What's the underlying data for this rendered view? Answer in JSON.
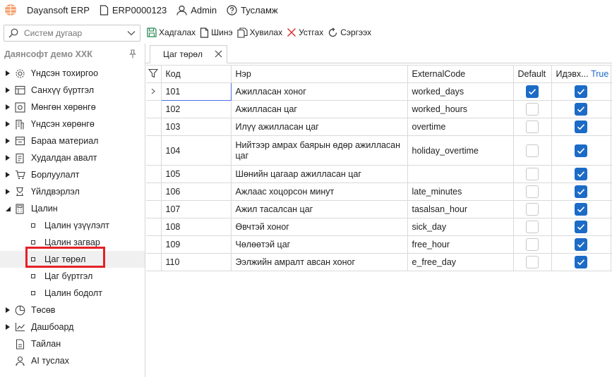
{
  "topbar": {
    "app_name": "Dayansoft ERP",
    "record": "ERP0000123",
    "user": "Admin",
    "help": "Тусламж"
  },
  "search": {
    "placeholder": "Систем дугаар"
  },
  "company": "Даянсофт демо ХХК",
  "nav": {
    "items": [
      {
        "label": "Үндсэн тохиргоо",
        "icon": "gear-icon"
      },
      {
        "label": "Санхүү бүртгэл",
        "icon": "ledger-icon"
      },
      {
        "label": "Мөнгөн хөрөнгө",
        "icon": "money-icon"
      },
      {
        "label": "Үндсэн хөрөнгө",
        "icon": "building-icon"
      },
      {
        "label": "Бараа материал",
        "icon": "box-icon"
      },
      {
        "label": "Худалдан авалт",
        "icon": "purchase-icon"
      },
      {
        "label": "Борлуулалт",
        "icon": "cart-icon"
      },
      {
        "label": "Үйлдвэрлэл",
        "icon": "factory-icon"
      },
      {
        "label": "Цалин",
        "icon": "calculator-icon"
      }
    ],
    "sub_items": [
      {
        "label": "Цалин үзүүлэлт"
      },
      {
        "label": "Цалин загвар"
      },
      {
        "label": "Цаг төрөл"
      },
      {
        "label": "Цаг бүртгэл"
      },
      {
        "label": "Цалин бодолт"
      }
    ],
    "bottom_items": [
      {
        "label": "Төсөв",
        "icon": "pie-chart-icon"
      },
      {
        "label": "Дашбоард",
        "icon": "dashboard-icon"
      },
      {
        "label": "Тайлан",
        "icon": "report-icon"
      },
      {
        "label": "AI туслах",
        "icon": "assistant-icon"
      }
    ]
  },
  "toolbar": {
    "save": "Хадгалах",
    "new": "Шинэ",
    "copy": "Хувилах",
    "delete": "Устгах",
    "refresh": "Сэргээх"
  },
  "tab": {
    "label": "Цаг төрөл"
  },
  "grid": {
    "columns": {
      "code": "Код",
      "name": "Нэр",
      "external": "ExternalCode",
      "default": "Default",
      "active": "Идэвх...",
      "active_filter": "True"
    },
    "rows": [
      {
        "code": "101",
        "name": "Ажилласан хоног",
        "external": "worked_days",
        "default": true,
        "active": true
      },
      {
        "code": "102",
        "name": "Ажилласан цаг",
        "external": "worked_hours",
        "default": false,
        "active": true
      },
      {
        "code": "103",
        "name": "Илүү ажилласан цаг",
        "external": "overtime",
        "default": false,
        "active": true
      },
      {
        "code": "104",
        "name": "Нийтээр амрах баярын өдөр ажилласан цаг",
        "external": "holiday_overtime",
        "default": false,
        "active": true
      },
      {
        "code": "105",
        "name": "Шөнийн цагаар ажилласан цаг",
        "external": "",
        "default": false,
        "active": true
      },
      {
        "code": "106",
        "name": "Ажлаас хоцорсон минут",
        "external": "late_minutes",
        "default": false,
        "active": true
      },
      {
        "code": "107",
        "name": "Ажил тасалсан цаг",
        "external": "tasalsan_hour",
        "default": false,
        "active": true
      },
      {
        "code": "108",
        "name": "Өвчтэй хоног",
        "external": "sick_day",
        "default": false,
        "active": true
      },
      {
        "code": "109",
        "name": "Чөлөөтэй цаг",
        "external": "free_hour",
        "default": false,
        "active": true
      },
      {
        "code": "110",
        "name": "Ээлжийн амралт авсан хоног",
        "external": "e_free_day",
        "default": false,
        "active": true
      }
    ]
  },
  "colors": {
    "accent": "#1c6bc7",
    "highlight": "#e32226"
  }
}
